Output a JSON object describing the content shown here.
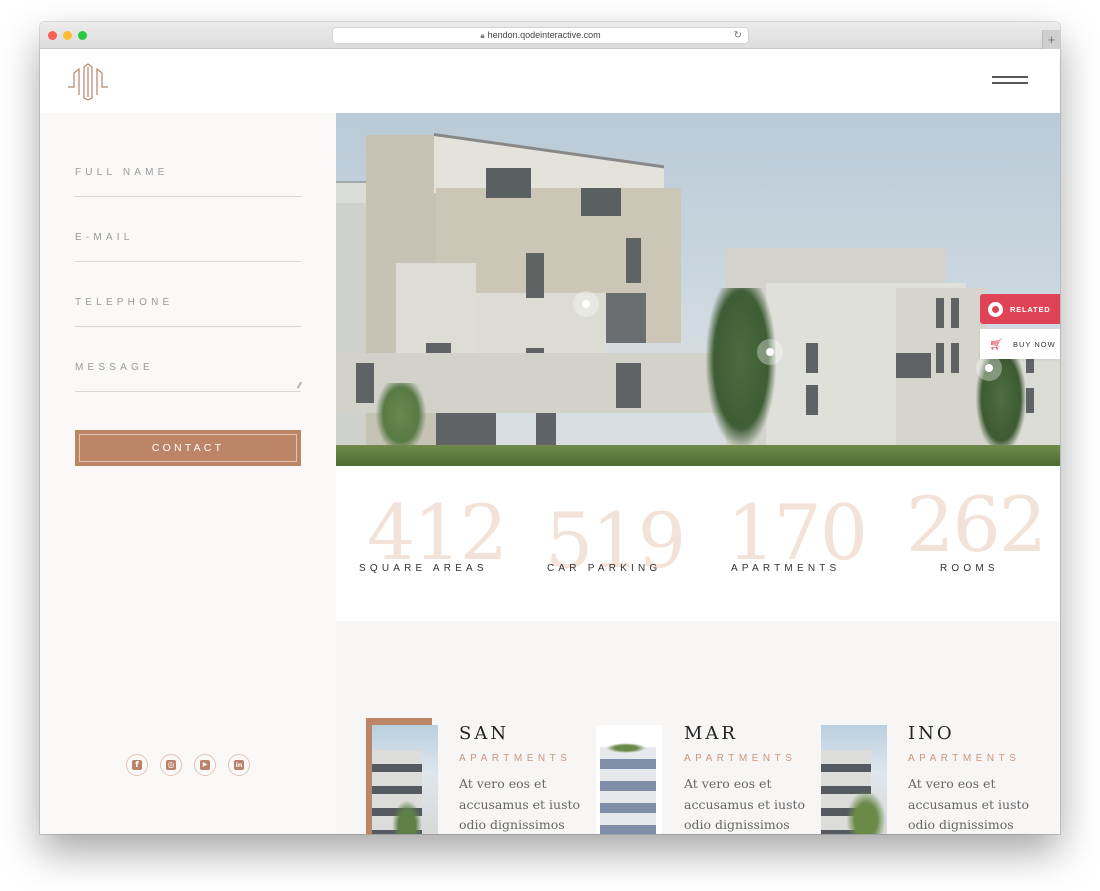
{
  "browser": {
    "url": "hendon.qodeinteractive.com",
    "new_tab_label": "+"
  },
  "header": {
    "logo_icon": "building-monogram-logo",
    "menu_icon": "hamburger-menu-icon"
  },
  "contact_form": {
    "fields": [
      {
        "placeholder": "FULL NAME",
        "value": ""
      },
      {
        "placeholder": "E-MAIL",
        "value": ""
      },
      {
        "placeholder": "TELEPHONE",
        "value": ""
      },
      {
        "placeholder": "MESSAGE",
        "value": ""
      }
    ],
    "submit_label": "CONTACT"
  },
  "socials": [
    {
      "name": "facebook",
      "glyph": "f"
    },
    {
      "name": "instagram",
      "glyph": "◎"
    },
    {
      "name": "youtube",
      "glyph": "▶"
    },
    {
      "name": "linkedin",
      "glyph": "in"
    }
  ],
  "side_tabs": {
    "related_label": "RELATED",
    "buy_now_label": "BUY NOW",
    "accent_color": "#e04356"
  },
  "stats": [
    {
      "number": "412",
      "label": "SQUARE AREAS"
    },
    {
      "number": "519",
      "label": "CAR PARKING"
    },
    {
      "number": "170",
      "label": "APARTMENTS"
    },
    {
      "number": "262",
      "label": "ROOMS"
    }
  ],
  "apartments": [
    {
      "name": "SAN",
      "type": "APARTMENTS",
      "description": "At vero eos et accusamus et iusto odio dignissimos"
    },
    {
      "name": "MAR",
      "type": "APARTMENTS",
      "description": "At vero eos et accusamus et iusto odio dignissimos"
    },
    {
      "name": "INO",
      "type": "APARTMENTS",
      "description": "At vero eos et accusamus et iusto odio dignissimos"
    }
  ],
  "colors": {
    "brand": "#bb8566",
    "stat_number": "#f3e2d8",
    "related": "#e04356"
  }
}
